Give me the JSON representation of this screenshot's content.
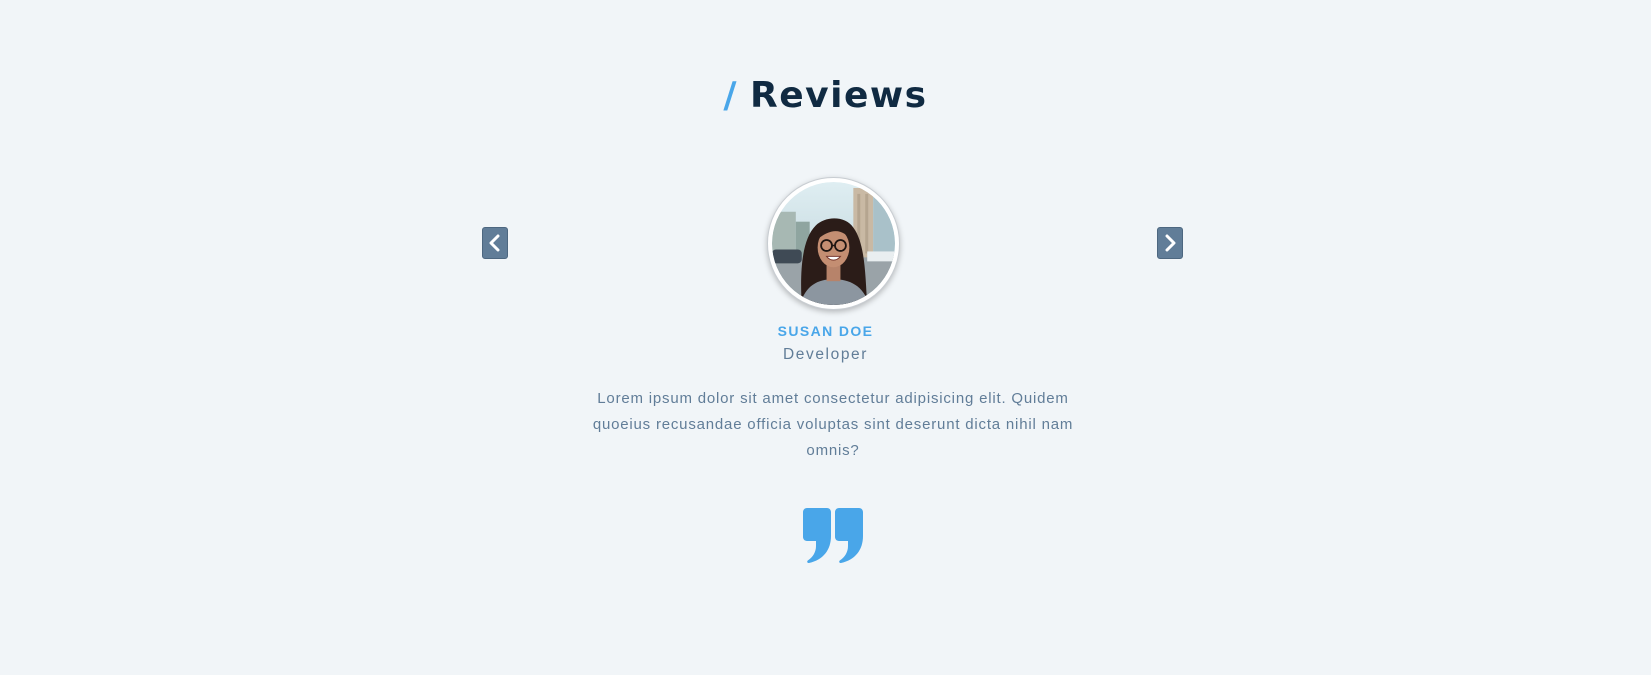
{
  "section": {
    "title_prefix": "/",
    "title": "Reviews"
  },
  "nav": {
    "prev_icon": "chevron-left-icon",
    "next_icon": "chevron-right-icon"
  },
  "review": {
    "name": "susan doe",
    "job": "Developer",
    "text": "Lorem ipsum dolor sit amet consectetur adipisicing elit. Quidem quoeius recusandae officia voluptas sint deserunt dicta nihil nam omnis?",
    "quote_icon": "quote-right-icon"
  },
  "colors": {
    "background": "#f1f5f8",
    "accent": "#49a6e9",
    "title": "#102a42",
    "muted": "#617d98"
  }
}
